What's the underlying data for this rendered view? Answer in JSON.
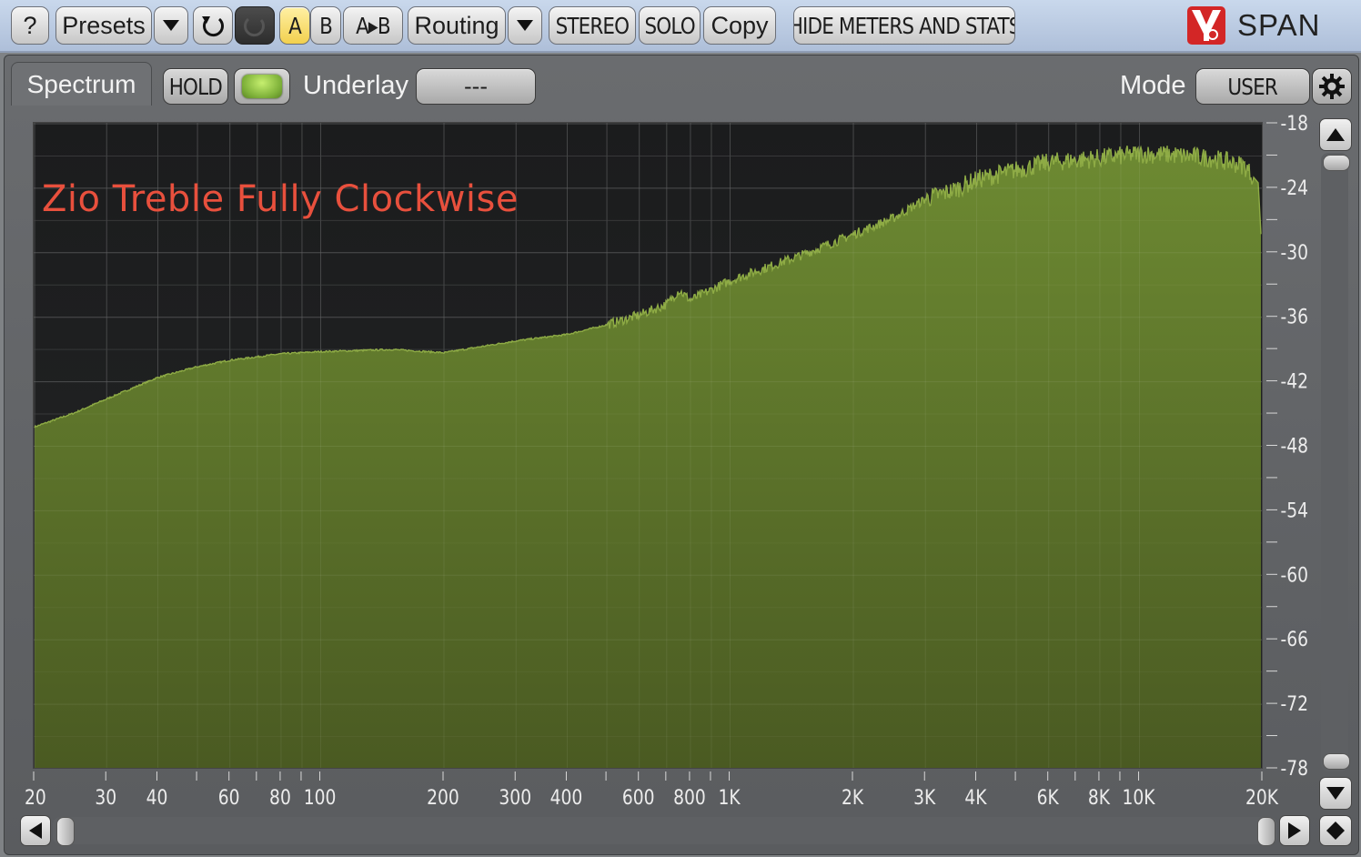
{
  "toolbar": {
    "help_label": "?",
    "presets_label": "Presets",
    "ab_a_label": "A",
    "ab_b_label": "B",
    "ab_copy_label": "A▸B",
    "routing_label": "Routing",
    "stereo_label": "STEREO",
    "solo_label": "SOLO",
    "copy_label": "Copy",
    "hide_meters_label": "HIDE METERS AND STATS",
    "brand": "SPAN"
  },
  "panel": {
    "tab_label": "Spectrum",
    "hold_label": "HOLD",
    "underlay_label": "Underlay",
    "underlay_value": "---",
    "mode_label": "Mode",
    "mode_value": "USER"
  },
  "overlay_title": "Zio Treble Fully Clockwise",
  "colors": {
    "spectrum_fill_top": "#6d8a32",
    "spectrum_fill_bottom": "#4a5a22",
    "overlay_text": "#e8503d",
    "led": "#9ccf4a"
  },
  "chart_data": {
    "type": "area",
    "title": "",
    "xlabel": "",
    "ylabel": "",
    "x_scale": "log",
    "xlim": [
      20,
      20000
    ],
    "ylim": [
      -78,
      -18
    ],
    "grid": true,
    "x_tick_labels": [
      "20",
      "30",
      "40",
      "60",
      "80",
      "100",
      "200",
      "300",
      "400",
      "600",
      "800",
      "1K",
      "2K",
      "3K",
      "4K",
      "6K",
      "8K",
      "10K",
      "20K"
    ],
    "x_tick_values": [
      20,
      30,
      40,
      60,
      80,
      100,
      200,
      300,
      400,
      600,
      800,
      1000,
      2000,
      3000,
      4000,
      6000,
      8000,
      10000,
      20000
    ],
    "y_tick_labels": [
      "-18",
      "-24",
      "-30",
      "-36",
      "-42",
      "-48",
      "-54",
      "-60",
      "-66",
      "-72",
      "-78"
    ],
    "y_tick_values": [
      -18,
      -24,
      -30,
      -36,
      -42,
      -48,
      -54,
      -60,
      -66,
      -72,
      -78
    ],
    "x": [
      20,
      25,
      30,
      40,
      50,
      60,
      80,
      100,
      150,
      200,
      300,
      400,
      500,
      600,
      700,
      750,
      800,
      1000,
      1500,
      2000,
      2500,
      3000,
      3500,
      4000,
      5000,
      6000,
      8000,
      10000,
      12000,
      15000,
      18000,
      19500,
      20000
    ],
    "y": [
      -46.2,
      -44.9,
      -43.6,
      -41.6,
      -40.6,
      -40.0,
      -39.4,
      -39.2,
      -39.0,
      -39.3,
      -38.2,
      -37.6,
      -36.7,
      -35.8,
      -34.8,
      -33.5,
      -34.4,
      -32.6,
      -30.2,
      -28.3,
      -26.8,
      -25.0,
      -24.2,
      -23.2,
      -22.3,
      -21.6,
      -21.2,
      -20.8,
      -20.9,
      -21.2,
      -21.9,
      -23.5,
      -31.5
    ]
  }
}
